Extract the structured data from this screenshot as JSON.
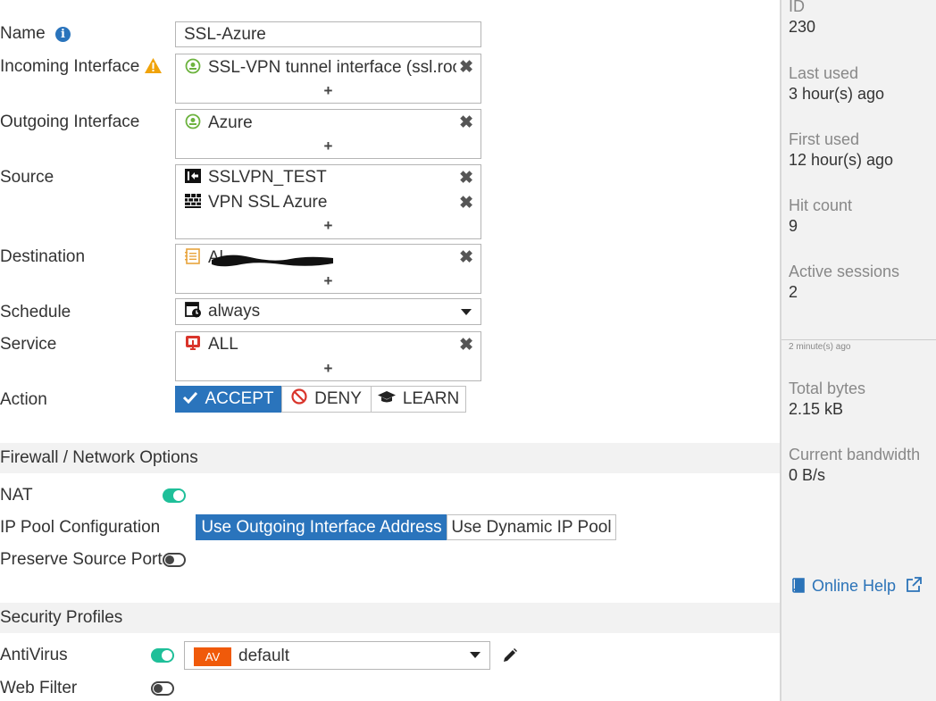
{
  "form": {
    "name": {
      "label": "Name",
      "value": "SSL-Azure"
    },
    "incoming": {
      "label": "Incoming Interface",
      "items": [
        "SSL-VPN tunnel interface (ssl.root"
      ]
    },
    "outgoing": {
      "label": "Outgoing Interface",
      "items": [
        "Azure"
      ]
    },
    "source": {
      "label": "Source",
      "items": [
        "SSLVPN_TEST",
        "VPN SSL Azure"
      ]
    },
    "destination": {
      "label": "Destination",
      "items": [
        "Al"
      ]
    },
    "schedule": {
      "label": "Schedule",
      "value": "always"
    },
    "service": {
      "label": "Service",
      "items": [
        "ALL"
      ]
    },
    "action": {
      "label": "Action",
      "accept": "ACCEPT",
      "deny": "DENY",
      "learn": "LEARN",
      "selected": "ACCEPT"
    },
    "add_symbol": "+",
    "remove_symbol": "✖"
  },
  "firewall_section": {
    "title": "Firewall / Network Options",
    "nat_label": "NAT",
    "nat_enabled": true,
    "ip_pool_label": "IP Pool Configuration",
    "ip_pool_options": [
      "Use Outgoing Interface Address",
      "Use Dynamic IP Pool"
    ],
    "ip_pool_selected": "Use Outgoing Interface Address",
    "preserve_label": "Preserve Source Port",
    "preserve_enabled": false
  },
  "security_section": {
    "title": "Security Profiles",
    "antivirus_label": "AntiVirus",
    "antivirus_enabled": true,
    "antivirus_badge": "AV",
    "antivirus_profile": "default",
    "webfilter_label": "Web Filter",
    "webfilter_enabled": false
  },
  "side": {
    "id_label": "ID",
    "id_value": "230",
    "last_used_label": "Last used",
    "last_used_value": "3 hour(s) ago",
    "first_used_label": "First used",
    "first_used_value": "12 hour(s) ago",
    "hit_count_label": "Hit count",
    "hit_count_value": "9",
    "active_sessions_label": "Active sessions",
    "active_sessions_value": "2",
    "updated": "2 minute(s) ago",
    "total_bytes_label": "Total bytes",
    "total_bytes_value": "2.15 kB",
    "bandwidth_label": "Current bandwidth",
    "bandwidth_value": "0 B/s",
    "online_help": "Online Help"
  },
  "colors": {
    "accent": "#2a74bc",
    "toggle_on": "#1fbf99",
    "warning": "#f0a30a",
    "interface_icon": "#6db33f",
    "address_icon": "#e8a33c",
    "service_icon": "#d9342b",
    "av_badge": "#f05a0a"
  }
}
